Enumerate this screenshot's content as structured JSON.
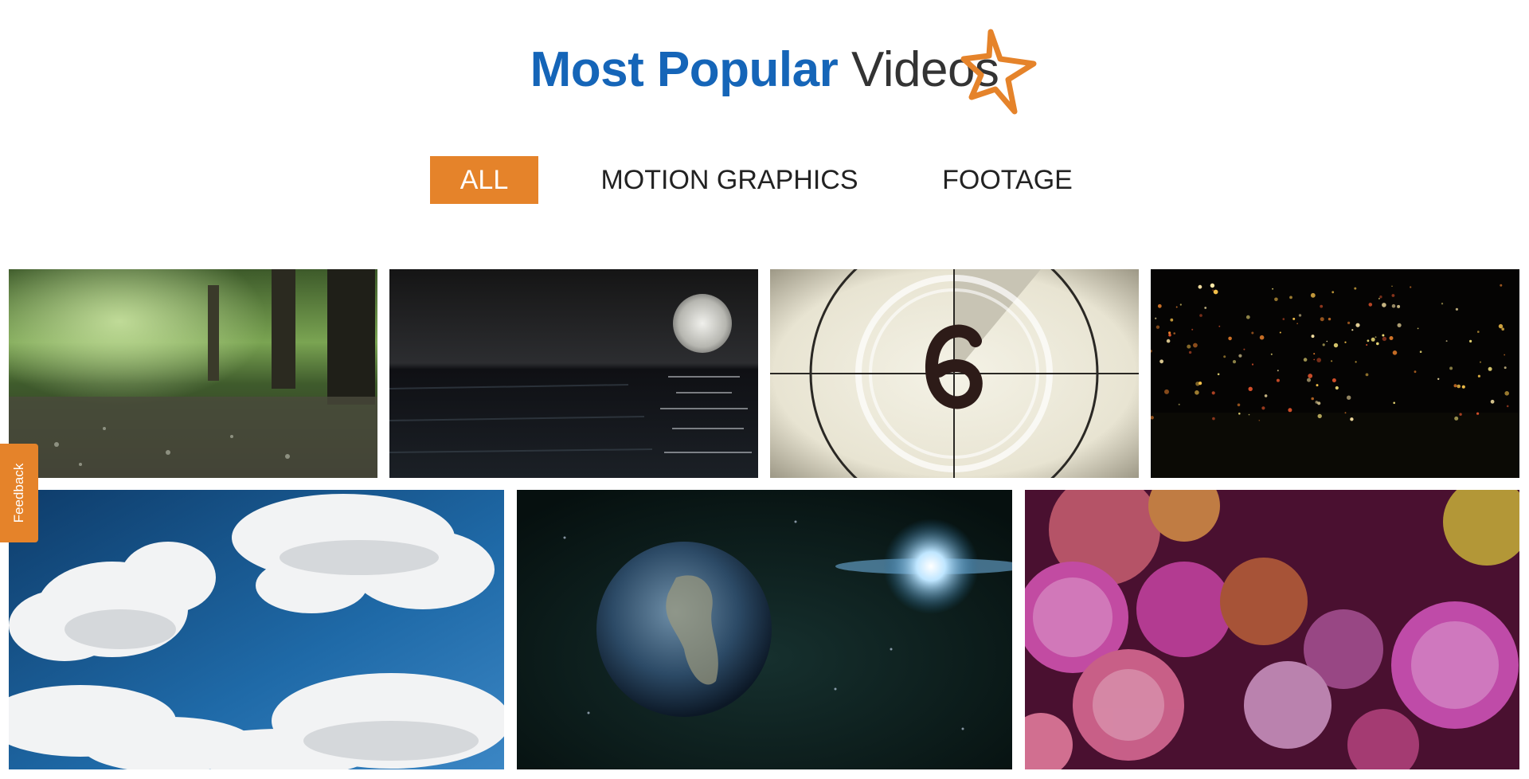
{
  "header": {
    "title_strong": "Most Popular",
    "title_light": "Videos",
    "star_icon": "star-outline-icon",
    "accent_color": "#e5832a",
    "brand_color": "#1565b8"
  },
  "filters": [
    {
      "label": "ALL",
      "active": true
    },
    {
      "label": "MOTION GRAPHICS",
      "active": false
    },
    {
      "label": "FOOTAGE",
      "active": false
    }
  ],
  "feedback": {
    "label": "Feedback"
  },
  "videos": [
    {
      "thumbnail": "rain-in-forest"
    },
    {
      "thumbnail": "moon-over-ocean"
    },
    {
      "thumbnail": "film-countdown-6"
    },
    {
      "thumbnail": "golden-particles"
    },
    {
      "thumbnail": "clouds-blue-sky"
    },
    {
      "thumbnail": "earth-in-space"
    },
    {
      "thumbnail": "pink-bokeh"
    }
  ]
}
